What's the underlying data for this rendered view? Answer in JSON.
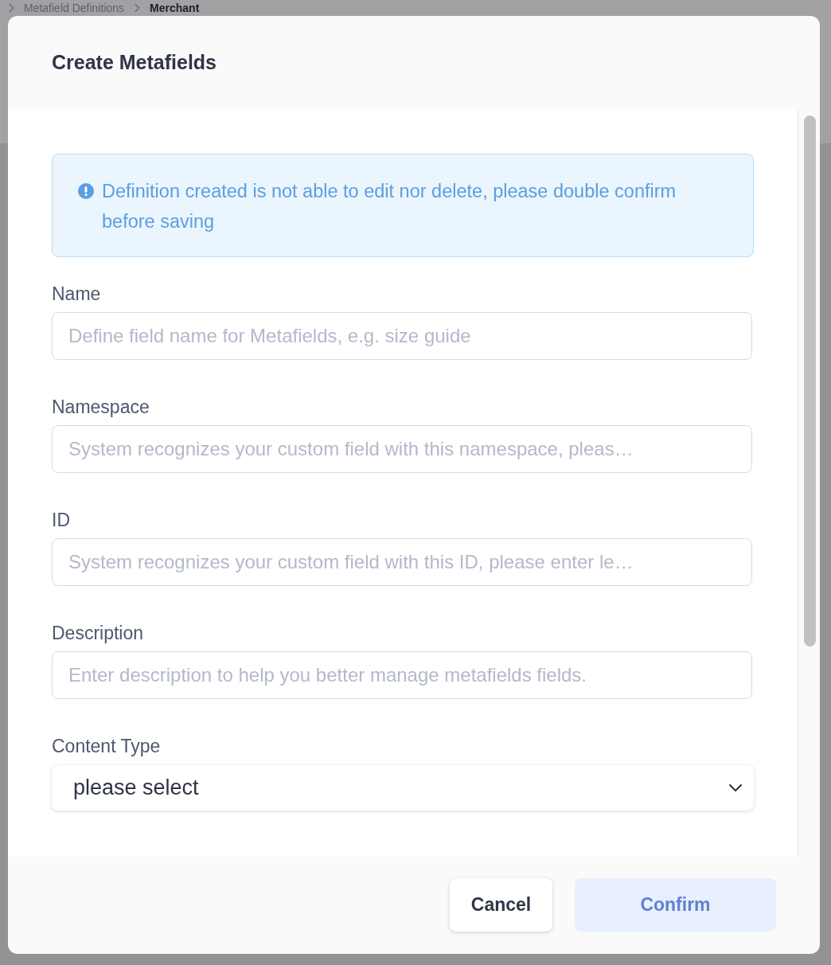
{
  "background_page": {
    "breadcrumb": [
      {
        "label": "Metafield Definitions",
        "current": false
      },
      {
        "label": "Merchant",
        "current": true
      }
    ]
  },
  "dialog": {
    "title": "Create Metafields",
    "notice": {
      "kind": "info",
      "text": "Definition created is not able to edit nor delete, please double confirm before saving"
    },
    "fields": [
      {
        "kind": "text",
        "label": "Name",
        "placeholder": "Define field name for Metafields, e.g. size guide"
      },
      {
        "kind": "text",
        "label": "Namespace",
        "placeholder": "System recognizes your custom field with this namespace, pleas…"
      },
      {
        "kind": "text",
        "label": "ID",
        "placeholder": "System recognizes your custom field with this ID, please enter le…"
      },
      {
        "kind": "text",
        "label": "Description",
        "placeholder": "Enter description to help you better manage metafields fields."
      },
      {
        "kind": "select",
        "label": "Content Type",
        "value": "please select"
      }
    ],
    "buttons": [
      {
        "label": "Cancel",
        "kind": "secondary",
        "disabled": false
      },
      {
        "label": "Confirm",
        "kind": "primary",
        "disabled": true
      }
    ]
  }
}
